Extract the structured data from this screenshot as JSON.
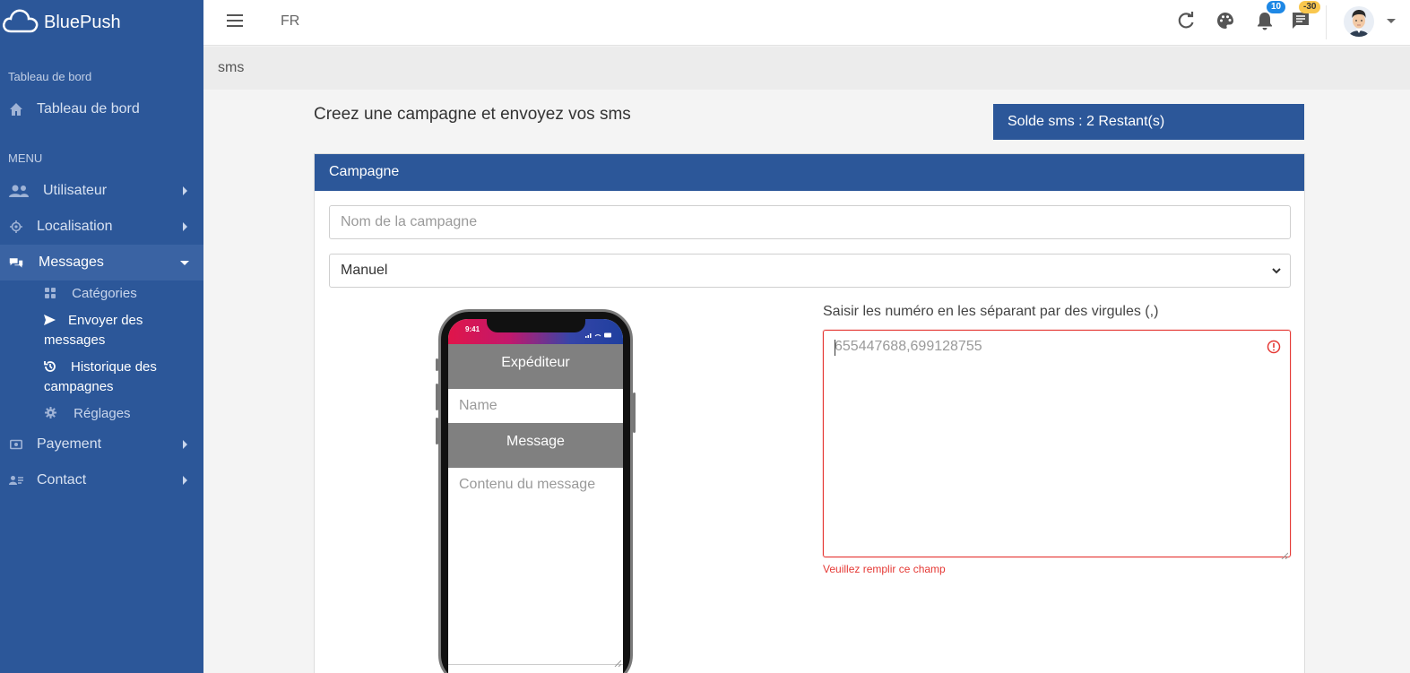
{
  "brand": {
    "name": "BluePush"
  },
  "sidebar": {
    "dashboard_section": "Tableau de bord",
    "dashboard_item": "Tableau de bord",
    "menu_section": "MENU",
    "items": [
      {
        "label": "Utilisateur",
        "icon": "users-icon"
      },
      {
        "label": "Localisation",
        "icon": "location-icon"
      },
      {
        "label": "Messages",
        "icon": "chat-icon"
      },
      {
        "label": "Payement",
        "icon": "money-icon"
      },
      {
        "label": "Contact",
        "icon": "contact-icon"
      }
    ],
    "sub_items": [
      {
        "label": "Catégories",
        "icon": "grid-icon"
      },
      {
        "label": "Envoyer des",
        "label2": "messages",
        "icon": "send-icon"
      },
      {
        "label": "Historique des",
        "label2": "campagnes",
        "icon": "history-icon"
      },
      {
        "label": "Réglages",
        "icon": "gear-icon"
      }
    ]
  },
  "topbar": {
    "language": "FR",
    "notifications_count": "10",
    "messages_count": "-30"
  },
  "breadcrumb": {
    "current": "sms"
  },
  "main": {
    "title": "Creez une campagne et envoyez vos sms",
    "balance": "Solde sms : 2 Restant(s)",
    "card_title": "Campagne",
    "campaign_name_placeholder": "Nom de la campagne",
    "mode_select_value": "Manuel",
    "numbers_label": "Saisir les numéro en les séparant par des virgules (,)",
    "numbers_placeholder": "655447688,699128755",
    "error_message": "Veuillez remplir ce champ"
  },
  "phone": {
    "time": "9:41",
    "sender_header": "Expéditeur",
    "name_placeholder": "Name",
    "message_header": "Message",
    "message_placeholder": "Contenu du message"
  },
  "colors": {
    "primary": "#2c5799",
    "active_item": "#3a63a3",
    "error": "#e53935"
  }
}
